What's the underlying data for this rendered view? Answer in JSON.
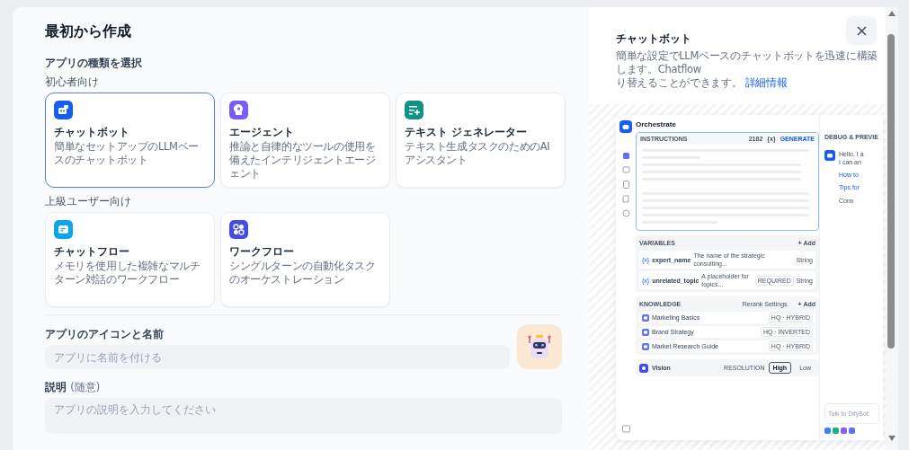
{
  "title": "最初から作成",
  "type_heading": "アプリの種類を選択",
  "groups": [
    {
      "label": "初心者向け",
      "apps": [
        {
          "kind": "chatbot",
          "name": "チャットボット",
          "description": "簡単なセットアップのLLMベースのチャットボット",
          "color": "#155eef",
          "selected": true
        },
        {
          "kind": "agent",
          "name": "エージェント",
          "description": "推論と自律的なツールの使用を備えたインテリジェントエージェント",
          "color": "#7a5af8",
          "selected": false
        },
        {
          "kind": "textgen",
          "name": "テキスト ジェネレーター",
          "description": "テキスト生成タスクのためのAIアシスタント",
          "color": "#0e9384",
          "selected": false
        }
      ]
    },
    {
      "label": "上級ユーザー向け",
      "apps": [
        {
          "kind": "chatflow",
          "name": "チャットフロー",
          "description": "メモリを使用した複雑なマルチターン対話のワークフロー",
          "color": "#0ba5ec",
          "selected": false
        },
        {
          "kind": "workflow",
          "name": "ワークフロー",
          "description": "シングルターンの自動化タスクのオーケストレーション",
          "color": "#444ce7",
          "selected": false
        }
      ]
    }
  ],
  "name_field": {
    "label": "アプリのアイコンと名前",
    "placeholder": "アプリに名前を付ける"
  },
  "description_field": {
    "label": "説明",
    "hint": "(随意)",
    "placeholder": "アプリの説明を入力してください"
  },
  "preview": {
    "title": "チャットボット",
    "description_lines": [
      "簡単な設定でLLMベースのチャットボットを迅速に構築します。Chatflow",
      "り替えることができます。"
    ],
    "link": "詳細情報",
    "screenshot": {
      "app_title": "Orchestrate",
      "instructions": {
        "label": "INSTRUCTIONS",
        "count": "2182",
        "variable": "{x}",
        "generate": "GENERATE"
      },
      "variables": {
        "label": "VARIABLES",
        "add": "+ Add",
        "rows": [
          {
            "prefix": "{x}",
            "name": "expert_name",
            "description": "The name of the strategic consulting...",
            "required": false,
            "type": "String"
          },
          {
            "prefix": "{x}",
            "name": "unrelated_topic",
            "description": "A placeholder for topics...",
            "required": true,
            "required_label": "REQUIRED",
            "type": "String"
          }
        ]
      },
      "knowledge": {
        "label": "KNOWLEDGE",
        "rerank": "Rerank Settings",
        "add": "+ Add",
        "items": [
          {
            "name": "Marketing Basics",
            "tag": "HQ · HYBRID"
          },
          {
            "name": "Brand Strategy",
            "tag": "HQ · INVERTED"
          },
          {
            "name": "Market Research Guide",
            "tag": "HQ · HYBRID"
          }
        ]
      },
      "vision": {
        "label": "Vision",
        "resolution": "RESOLUTION",
        "options": [
          {
            "label": "High",
            "selected": true
          },
          {
            "label": "Low",
            "selected": false
          }
        ]
      },
      "debug": {
        "title": "DEBUG & PREVIE",
        "lines": [
          "Hello, I a",
          "I can an"
        ],
        "links": [
          "How to",
          "Tips for"
        ],
        "note": "Conv",
        "input_placeholder": "Talk to DifyBot"
      }
    }
  }
}
